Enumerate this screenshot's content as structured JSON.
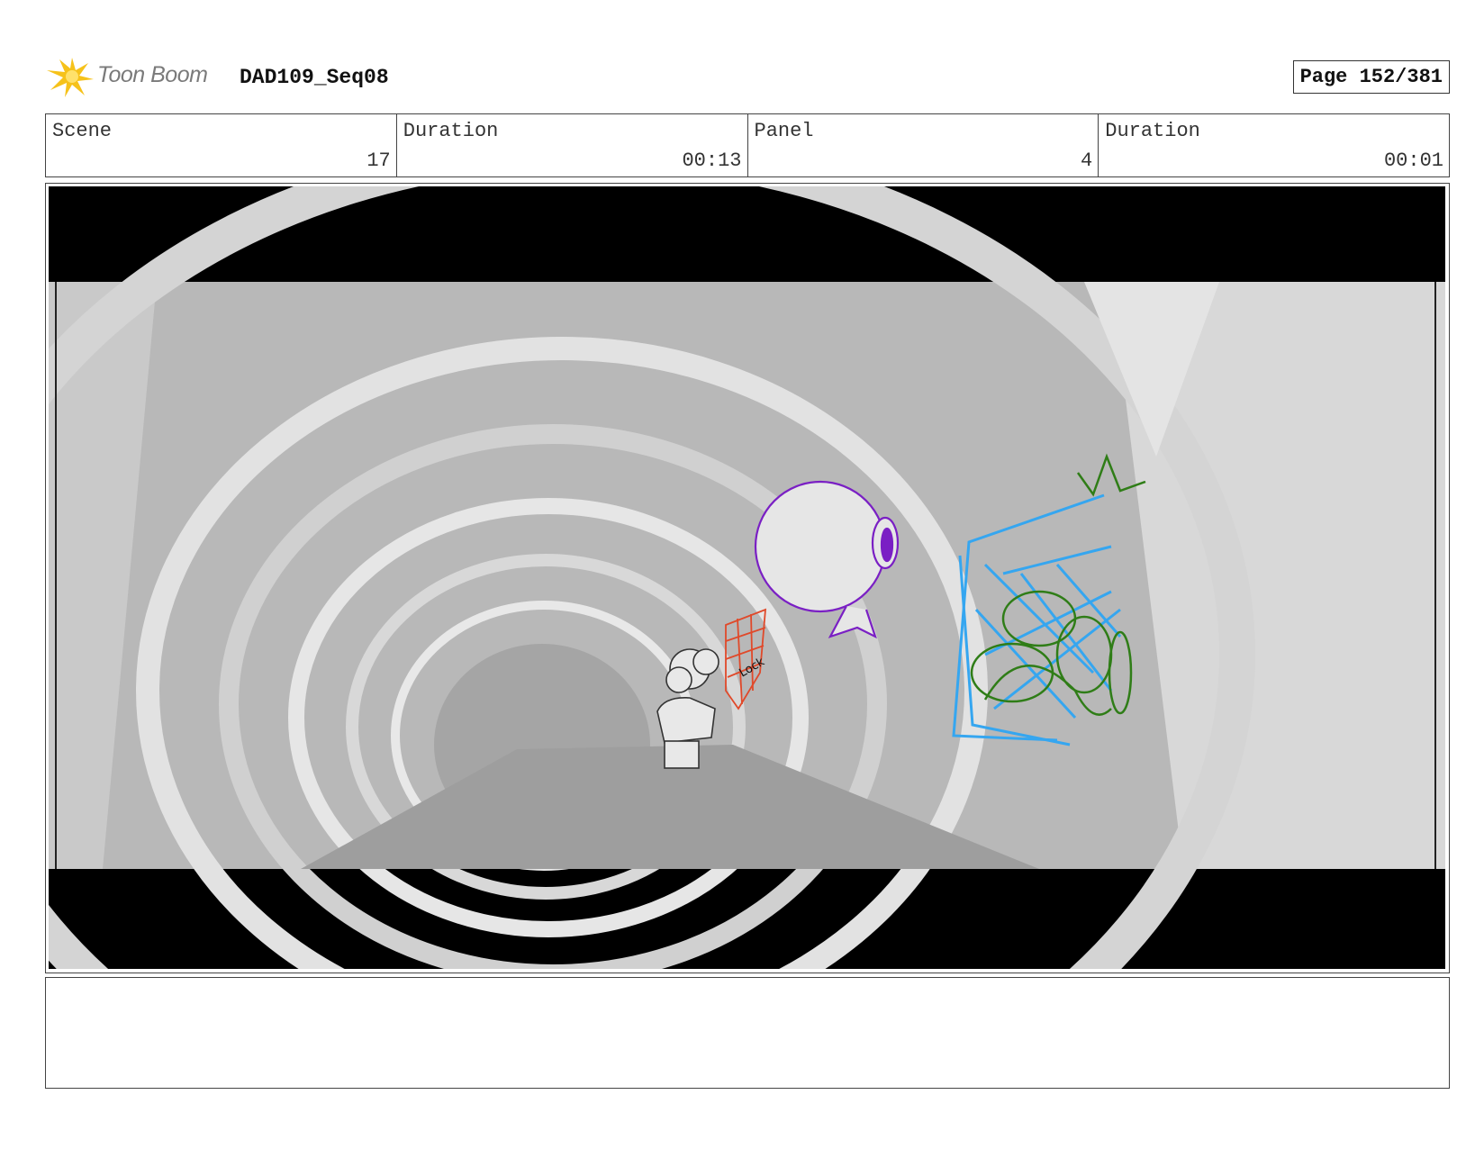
{
  "header": {
    "brand": "Toon Boom",
    "sequence": "DAD109_Seq08",
    "page": "Page 152/381"
  },
  "info": {
    "scene_label": "Scene",
    "scene_value": "17",
    "scene_duration_label": "Duration",
    "scene_duration_value": "00:13",
    "panel_label": "Panel",
    "panel_value": "4",
    "panel_duration_label": "Duration",
    "panel_duration_value": "00:01"
  },
  "panel_art": {
    "sketch_note": "Lock",
    "colors": {
      "lock_red": "#e0492a",
      "robot_purple": "#7a1fc4",
      "screen_blue": "#35a6f0",
      "plant_green": "#2f7d17",
      "letterbox": "#000000"
    }
  },
  "notes": {
    "text": ""
  }
}
